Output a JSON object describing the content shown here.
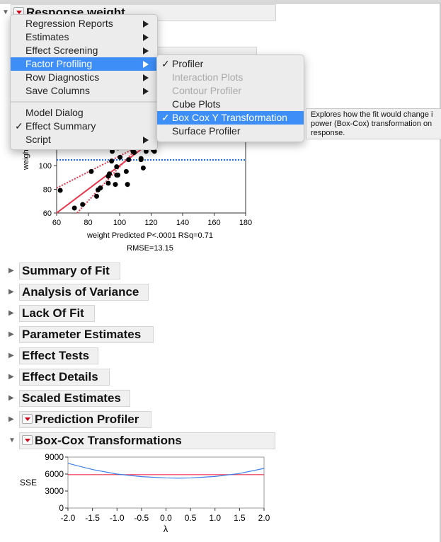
{
  "report": {
    "title": "Response weight"
  },
  "menu": {
    "items": [
      {
        "label": "Regression Reports",
        "submenu": true
      },
      {
        "label": "Estimates",
        "submenu": true
      },
      {
        "label": "Effect Screening",
        "submenu": true
      },
      {
        "label": "Factor Profiling",
        "submenu": true,
        "selected": true
      },
      {
        "label": "Row Diagnostics",
        "submenu": true
      },
      {
        "label": "Save Columns",
        "submenu": true
      },
      {
        "label": "Model Dialog"
      },
      {
        "label": "Effect Summary",
        "checked": true
      },
      {
        "label": "Script",
        "submenu": true
      }
    ]
  },
  "submenu": {
    "items": [
      {
        "label": "Profiler",
        "checked": true
      },
      {
        "label": "Interaction Plots",
        "disabled": true
      },
      {
        "label": "Contour Profiler",
        "disabled": true
      },
      {
        "label": "Cube Plots"
      },
      {
        "label": "Box Cox Y Transformation",
        "checked": true,
        "selected": true
      },
      {
        "label": "Surface Profiler"
      }
    ]
  },
  "tooltip": {
    "text": "Explores how the fit would change i power (Box-Cox) transformation on response."
  },
  "scatter": {
    "y_label": "weight",
    "x_label": "weight Predicted P<.0001 RSq=0.71",
    "x_label2": "RMSE=13.15",
    "x_ticks": [
      "60",
      "80",
      "100",
      "120",
      "140",
      "160",
      "180"
    ],
    "y_ticks": [
      "60",
      "80",
      "100"
    ],
    "mean_line": 104.8,
    "colors": {
      "fit": "#e8334a",
      "mean": "#1f6fe0",
      "points": "#000000"
    }
  },
  "sections": [
    {
      "label": "Summary of Fit",
      "expanded": false,
      "menu": false
    },
    {
      "label": "Analysis of Variance",
      "expanded": false,
      "menu": false
    },
    {
      "label": "Lack Of Fit",
      "expanded": false,
      "menu": false
    },
    {
      "label": "Parameter Estimates",
      "expanded": false,
      "menu": false
    },
    {
      "label": "Effect Tests",
      "expanded": false,
      "menu": false
    },
    {
      "label": "Effect Details",
      "expanded": false,
      "menu": false
    },
    {
      "label": "Scaled Estimates",
      "expanded": false,
      "menu": false
    },
    {
      "label": "Prediction Profiler",
      "expanded": false,
      "menu": true
    },
    {
      "label": "Box-Cox Transformations",
      "expanded": true,
      "menu": true
    }
  ],
  "chart_data": [
    {
      "type": "scatter",
      "xlabel": "weight Predicted P<.0001 RSq=0.71",
      "ylabel": "weight",
      "xlim": [
        60,
        180
      ],
      "ylim": [
        60,
        null
      ],
      "points": [
        [
          62.3,
          79.1
        ],
        [
          71.3,
          64.2
        ],
        [
          76.5,
          67.2
        ],
        [
          82,
          95
        ],
        [
          85.4,
          74.1
        ],
        [
          86.3,
          79.5
        ],
        [
          87.8,
          81.1
        ],
        [
          92.8,
          85.1
        ],
        [
          92.8,
          91
        ],
        [
          93.5,
          93
        ],
        [
          94.9,
          103.8
        ],
        [
          95.3,
          112
        ],
        [
          97.3,
          84.1
        ],
        [
          98.1,
          92
        ],
        [
          98.9,
          92
        ],
        [
          98.1,
          99
        ],
        [
          98.9,
          114.9
        ],
        [
          100.3,
          107
        ],
        [
          104.2,
          95
        ],
        [
          105,
          84.1
        ],
        [
          105.7,
          105
        ],
        [
          108.5,
          112
        ],
        [
          109.3,
          111
        ],
        [
          113.6,
          105
        ],
        [
          113.6,
          106
        ],
        [
          115,
          98
        ],
        [
          116.8,
          112
        ],
        [
          121.4,
          113
        ],
        [
          122.1,
          112
        ],
        [
          96,
          118
        ],
        [
          103,
          121
        ]
      ],
      "fit_line": [
        [
          60,
          60
        ],
        [
          180,
          180
        ]
      ],
      "mean": 104.8
    },
    {
      "type": "line",
      "xlabel": "λ",
      "ylabel": "SSE",
      "xlim": [
        -2,
        2
      ],
      "ylim": [
        0,
        9000
      ],
      "x_ticks": [
        "-2.0",
        "-1.5",
        "-1.0",
        "-0.5",
        "0.0",
        "0.5",
        "1.0",
        "1.5",
        "2.0"
      ],
      "y_ticks": [
        "0",
        "3000",
        "6000",
        "9000"
      ],
      "series": [
        {
          "x": [
            -2,
            -1.5,
            -1,
            -0.5,
            0,
            0.25,
            0.5,
            1,
            1.5,
            2
          ],
          "y": [
            7900,
            6800,
            6000,
            5550,
            5320,
            5280,
            5320,
            5580,
            6100,
            7000
          ]
        }
      ],
      "reference_line": 5900,
      "colors": {
        "curve": "#3a7fe8",
        "reference": "#e8334a"
      }
    }
  ]
}
